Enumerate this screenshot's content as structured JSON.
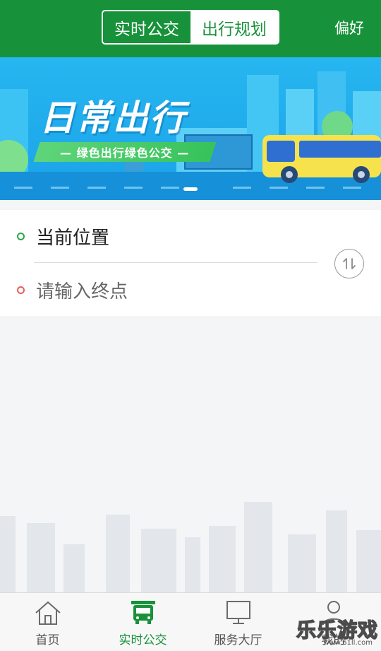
{
  "header": {
    "tabs": [
      {
        "label": "实时公交",
        "selected": false
      },
      {
        "label": "出行规划",
        "selected": true
      }
    ],
    "preference_label": "偏好",
    "colors": {
      "brand": "#17923a"
    }
  },
  "banner": {
    "title": "日常出行",
    "subtitle": "— 绿色出行绿色公交 —",
    "pager_count": 1,
    "pager_active": 0
  },
  "route": {
    "origin_value": "当前位置",
    "destination_placeholder": "请输入终点",
    "swap_icon": "swap-vertical-icon"
  },
  "tabbar": {
    "items": [
      {
        "label": "首页",
        "icon": "home-icon",
        "active": false
      },
      {
        "label": "实时公交",
        "icon": "bus-icon",
        "active": true
      },
      {
        "label": "服务大厅",
        "icon": "monitor-icon",
        "active": false
      },
      {
        "label": "我的",
        "icon": "user-icon",
        "active": false
      }
    ]
  },
  "watermark": {
    "text": "乐乐游戏",
    "url": "www.61ll.com"
  }
}
